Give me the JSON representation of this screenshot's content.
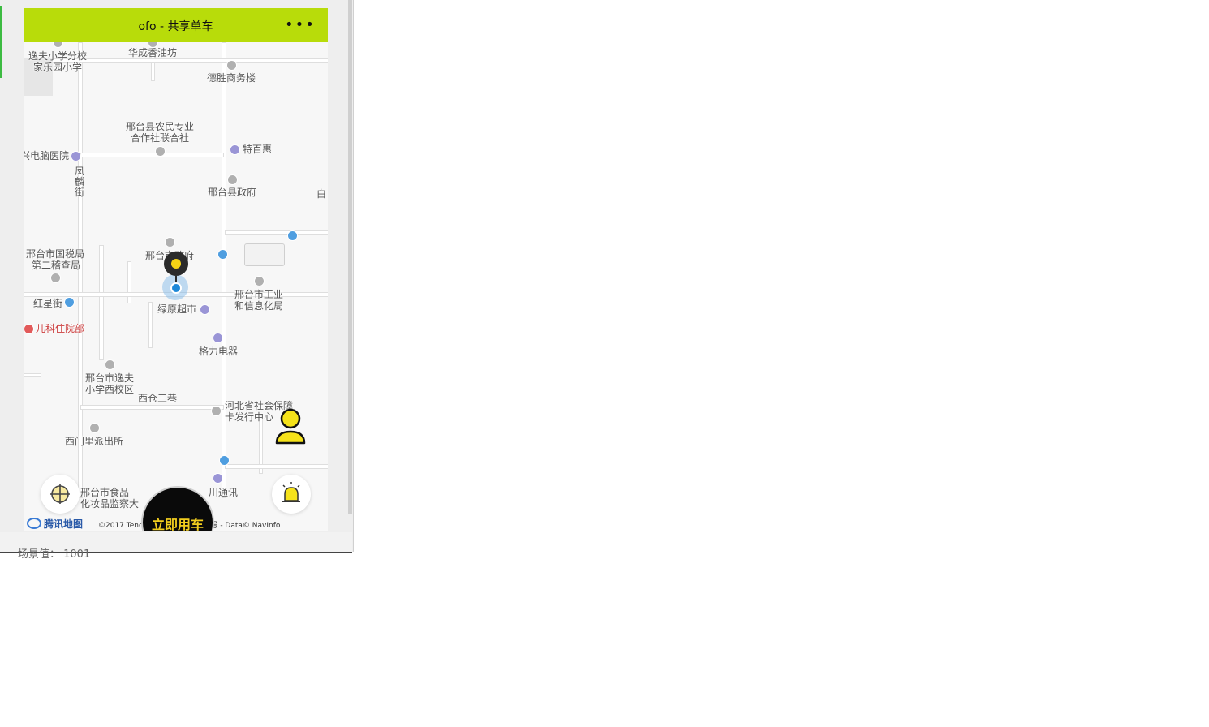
{
  "window": {
    "bottom_cutoff_text": "场景值：  1001"
  },
  "nav": {
    "title": "ofo - 共享单车",
    "more": "•••"
  },
  "map": {
    "labels": {
      "yifu_branch": "逸夫小学分校",
      "jialeyuan": "家乐园小学",
      "huacheng": "华成香油坊",
      "desheng": "德胜商务楼",
      "nongmin1": "邢台县农民专业",
      "nongmin2": "合作社联合社",
      "tebaihui": "特百惠",
      "diannao": "兴电脑医院",
      "fenglin1": "凤",
      "fenglin2": "麟",
      "fenglin3": "街",
      "xianzhengfu": "邢台县政府",
      "bai": "白",
      "guoshui1": "邢台市国税局",
      "guoshui2": "第二稽查局",
      "shizhengfu": "邢台市政府",
      "gongye1": "邢台市工业",
      "gongye2": "和信息化局",
      "hongxing": "红星街",
      "lvyuan": "绿原超市",
      "erke": "儿科住院部",
      "geli": "格力电器",
      "yifu_west1": "邢台市逸夫",
      "yifu_west2": "小学西校区",
      "xicang": "西仓三巷",
      "shebao1": "河北省社会保障",
      "shebao2": "卡发行中心",
      "ximenli": "西门里派出所",
      "shipin1": "邢台市食品",
      "shipin2": "化妆品监察大",
      "tongxun": "川通讯"
    },
    "ride_button": "立即用车",
    "logo_text": "腾讯地图",
    "copyright": "©2017 Tencent - GS(2016)930号 - Data© NavInfo"
  }
}
